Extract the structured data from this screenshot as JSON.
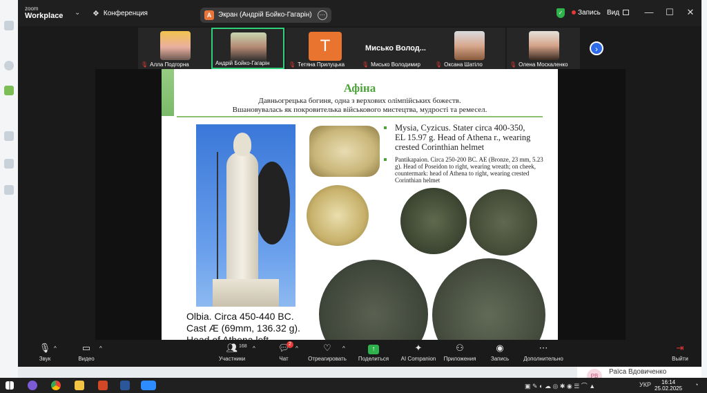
{
  "titlebar": {
    "brand_top": "zoom",
    "brand": "Workplace",
    "meetings": "Конференция",
    "screen_share_label": "Экран (Андрій Бойко-Гагарін)",
    "screen_share_badge": "A",
    "recording": "Запись",
    "view": "Вид"
  },
  "participants": [
    {
      "name": "Алла Подгорна",
      "muted": true
    },
    {
      "name": "Андрій Бойко-Гагарін",
      "muted": false,
      "active": true
    },
    {
      "name": "Тетяна Прилуцька",
      "muted": true,
      "initial": "T"
    },
    {
      "name": "Мисько Володимир",
      "muted": true,
      "display_name": "Мисько  Волод..."
    },
    {
      "name": "Оксана Шатіло",
      "muted": true
    },
    {
      "name": "Олена Москаленко",
      "muted": true
    }
  ],
  "slide": {
    "title": "Афіна",
    "subtitle_1": "Давньогрецька богиня, одна з верхових олімпійських божеств.",
    "subtitle_2": "Вшановувалась як покровителька військового мистецтва, мудрості та ремесел.",
    "bullet_1": "Mysia, Cyzicus. Stater circa 400-350, EL 15.97 g. Head of Athena r., wearing crested Corinthian helmet",
    "bullet_2": "Pantikapaion. Circa 250-200 BC. AE (Bronze, 23 mm, 5.23 g). Head of Poseidon to right, wearing wreath; on cheek, countermark: head of Athena to right, wearing crested Corinthian helmet",
    "caption_1": "Olbia. Circa 450-440 BC.",
    "caption_2": "Cast Æ (69mm, 136.32 g).",
    "caption_3": "Head of Athena left"
  },
  "toolbar": {
    "audio": "Звук",
    "video": "Видео",
    "participants": "Участники",
    "participants_count": "168",
    "chat": "Чат",
    "chat_badge": "2",
    "react": "Отреагировать",
    "share": "Поделиться",
    "ai": "AI Companion",
    "apps": "Приложения",
    "record": "Запись",
    "more": "Дополнительно",
    "leave": "Выйти"
  },
  "background_app": {
    "contact_initials": "PB",
    "contact_name": "Раїса Вдовиченко"
  },
  "taskbar": {
    "language": "УКР",
    "time": "16:14",
    "date": "25.02.2025"
  },
  "colors": {
    "active_speaker": "#2fd27a",
    "recording_dot": "#e53935",
    "share_green": "#2fb24c",
    "slide_title": "#4da33a"
  }
}
